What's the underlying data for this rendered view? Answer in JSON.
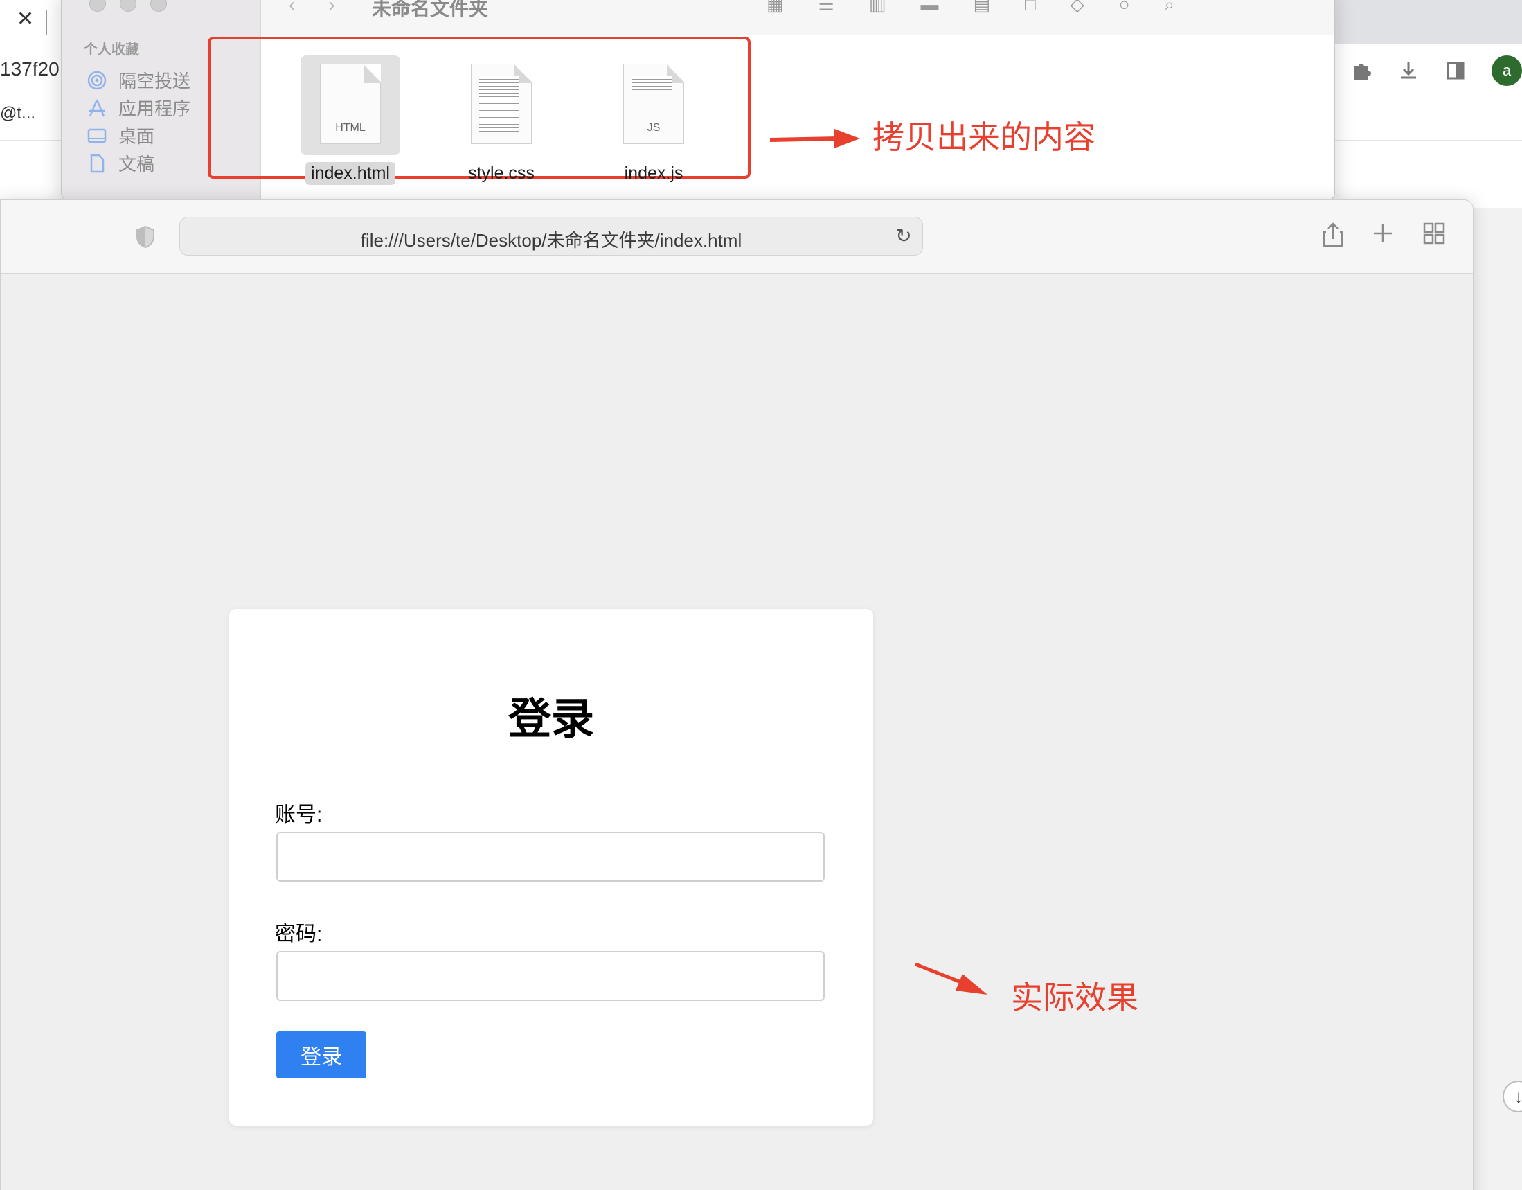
{
  "background_browser": {
    "tab_close": "✕",
    "url_fragment": "137f20",
    "bookmark_fragment": "@t...",
    "avatar_letter": "a"
  },
  "finder": {
    "toolbar_title": "未命名文件夹",
    "sidebar_heading": "个人收藏",
    "sidebar_items": [
      {
        "label": "隔空投送",
        "icon": "airdrop-icon"
      },
      {
        "label": "应用程序",
        "icon": "applications-icon"
      },
      {
        "label": "桌面",
        "icon": "desktop-icon"
      },
      {
        "label": "文稿",
        "icon": "documents-icon"
      }
    ],
    "files": [
      {
        "name": "index.html",
        "tag": "HTML",
        "selected": true
      },
      {
        "name": "style.css",
        "tag": "",
        "selected": false
      },
      {
        "name": "index.js",
        "tag": "JS",
        "selected": false
      }
    ]
  },
  "annotations": {
    "copied_content": "拷贝出来的内容",
    "actual_effect": "实际效果",
    "color": "#e8402f"
  },
  "safari": {
    "url": "file:///Users/te/Desktop/未命名文件夹/index.html"
  },
  "login": {
    "title": "登录",
    "account_label": "账号:",
    "account_value": "",
    "password_label": "密码:",
    "password_value": "",
    "button_label": "登录",
    "button_color": "#2f80f0"
  }
}
